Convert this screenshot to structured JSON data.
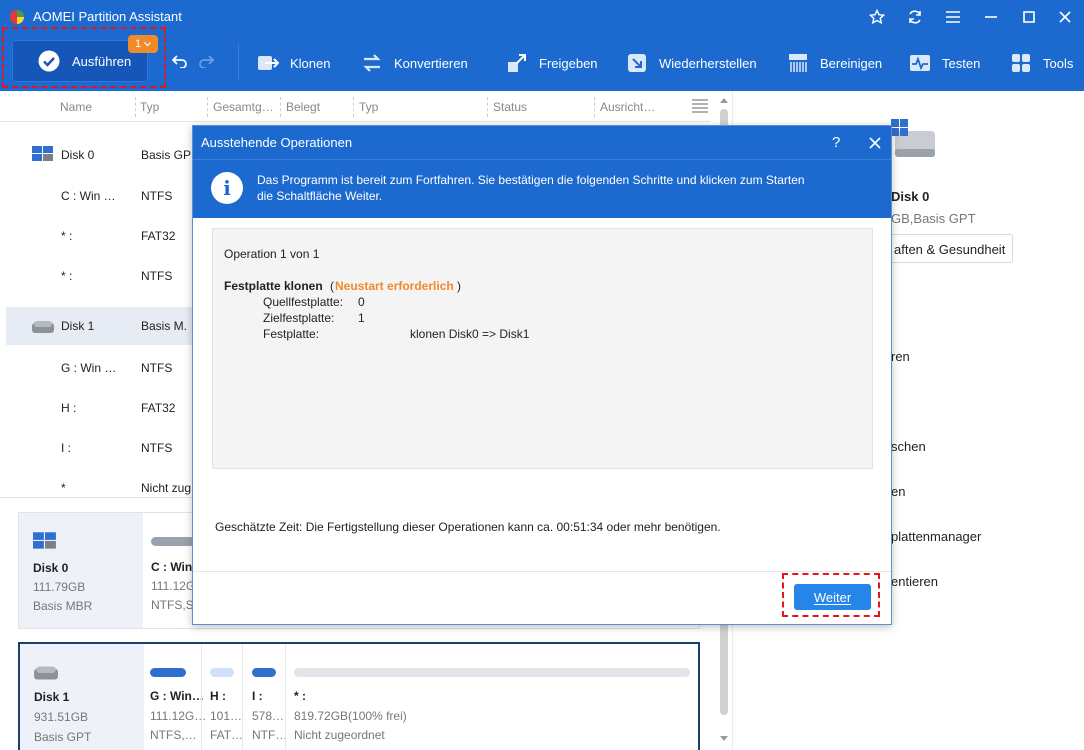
{
  "app": {
    "title": "AOMEI Partition Assistant"
  },
  "toolbar": {
    "run_label": "Ausführen",
    "pending_count": "1",
    "items": [
      "Klonen",
      "Konvertieren",
      "Freigeben",
      "Wiederherstellen",
      "Bereinigen",
      "Testen",
      "Tools"
    ]
  },
  "columns": [
    "Name",
    "Typ",
    "Gesamtg…",
    "Belegt",
    "Typ",
    "Status",
    "Ausricht…"
  ],
  "disk_rows": [
    {
      "name": "Disk 0",
      "type": "Basis GP"
    },
    {
      "name": "C : Win …",
      "type": "NTFS"
    },
    {
      "name": "* :",
      "type": "FAT32"
    },
    {
      "name": "* :",
      "type": "NTFS"
    },
    {
      "name": "Disk 1",
      "type": "Basis M."
    },
    {
      "name": "G : Win …",
      "type": "NTFS"
    },
    {
      "name": "H :",
      "type": "FAT32"
    },
    {
      "name": "I :",
      "type": "NTFS"
    },
    {
      "name": "*",
      "type": "Nicht zug"
    }
  ],
  "cards": {
    "disk0": {
      "name": "Disk 0",
      "size": "111.79GB",
      "type": "Basis MBR",
      "part_name": "C : Win",
      "part_size": "111.12GB",
      "part_fs": "NTFS,S"
    },
    "disk1": {
      "name": "Disk 1",
      "size": "931.51GB",
      "type": "Basis GPT",
      "parts": [
        {
          "name": "G : Win…",
          "size": "111.12G…",
          "fs": "NTFS,…"
        },
        {
          "name": "H :",
          "size": "101…",
          "fs": "FAT…"
        },
        {
          "name": "I :",
          "size": "578…",
          "fs": "NTF…"
        },
        {
          "name": "* :",
          "size": "819.72GB(100% frei)",
          "fs": "Nicht zugeordnet"
        }
      ]
    }
  },
  "right_panel": {
    "disk_name": "Disk 0",
    "disk_info": "GB,Basis GPT",
    "props_button": "aften & Gesundheit",
    "items": [
      "ren",
      "schen",
      "en",
      "plattenmanager",
      "entieren"
    ]
  },
  "dialog": {
    "title": "Ausstehende Operationen",
    "help": "?",
    "info_line1": "Das Programm ist bereit zum Fortfahren. Sie bestätigen die folgenden Schritte und klicken zum Starten",
    "info_line2": "die Schaltfläche Weiter.",
    "op_counter": "Operation 1 von 1",
    "op_title": "Festplatte klonen",
    "op_note": "Neustart erforderlich",
    "op_src_label": "Quellfestplatte:",
    "op_src_value": "0",
    "op_dst_label": "Zielfestplatte:",
    "op_dst_value": "1",
    "op_disk_label": "Festplatte:",
    "op_disk_value": "klonen Disk0 => Disk1",
    "estimate": "Geschätzte Zeit: Die Fertigstellung dieser Operationen kann ca. 00:51:34 oder mehr benötigen.",
    "next_button": "Weiter"
  },
  "colors": {
    "accent": "#1c6ad0",
    "warning": "#f08a2a",
    "highlight": "#e8151b"
  }
}
